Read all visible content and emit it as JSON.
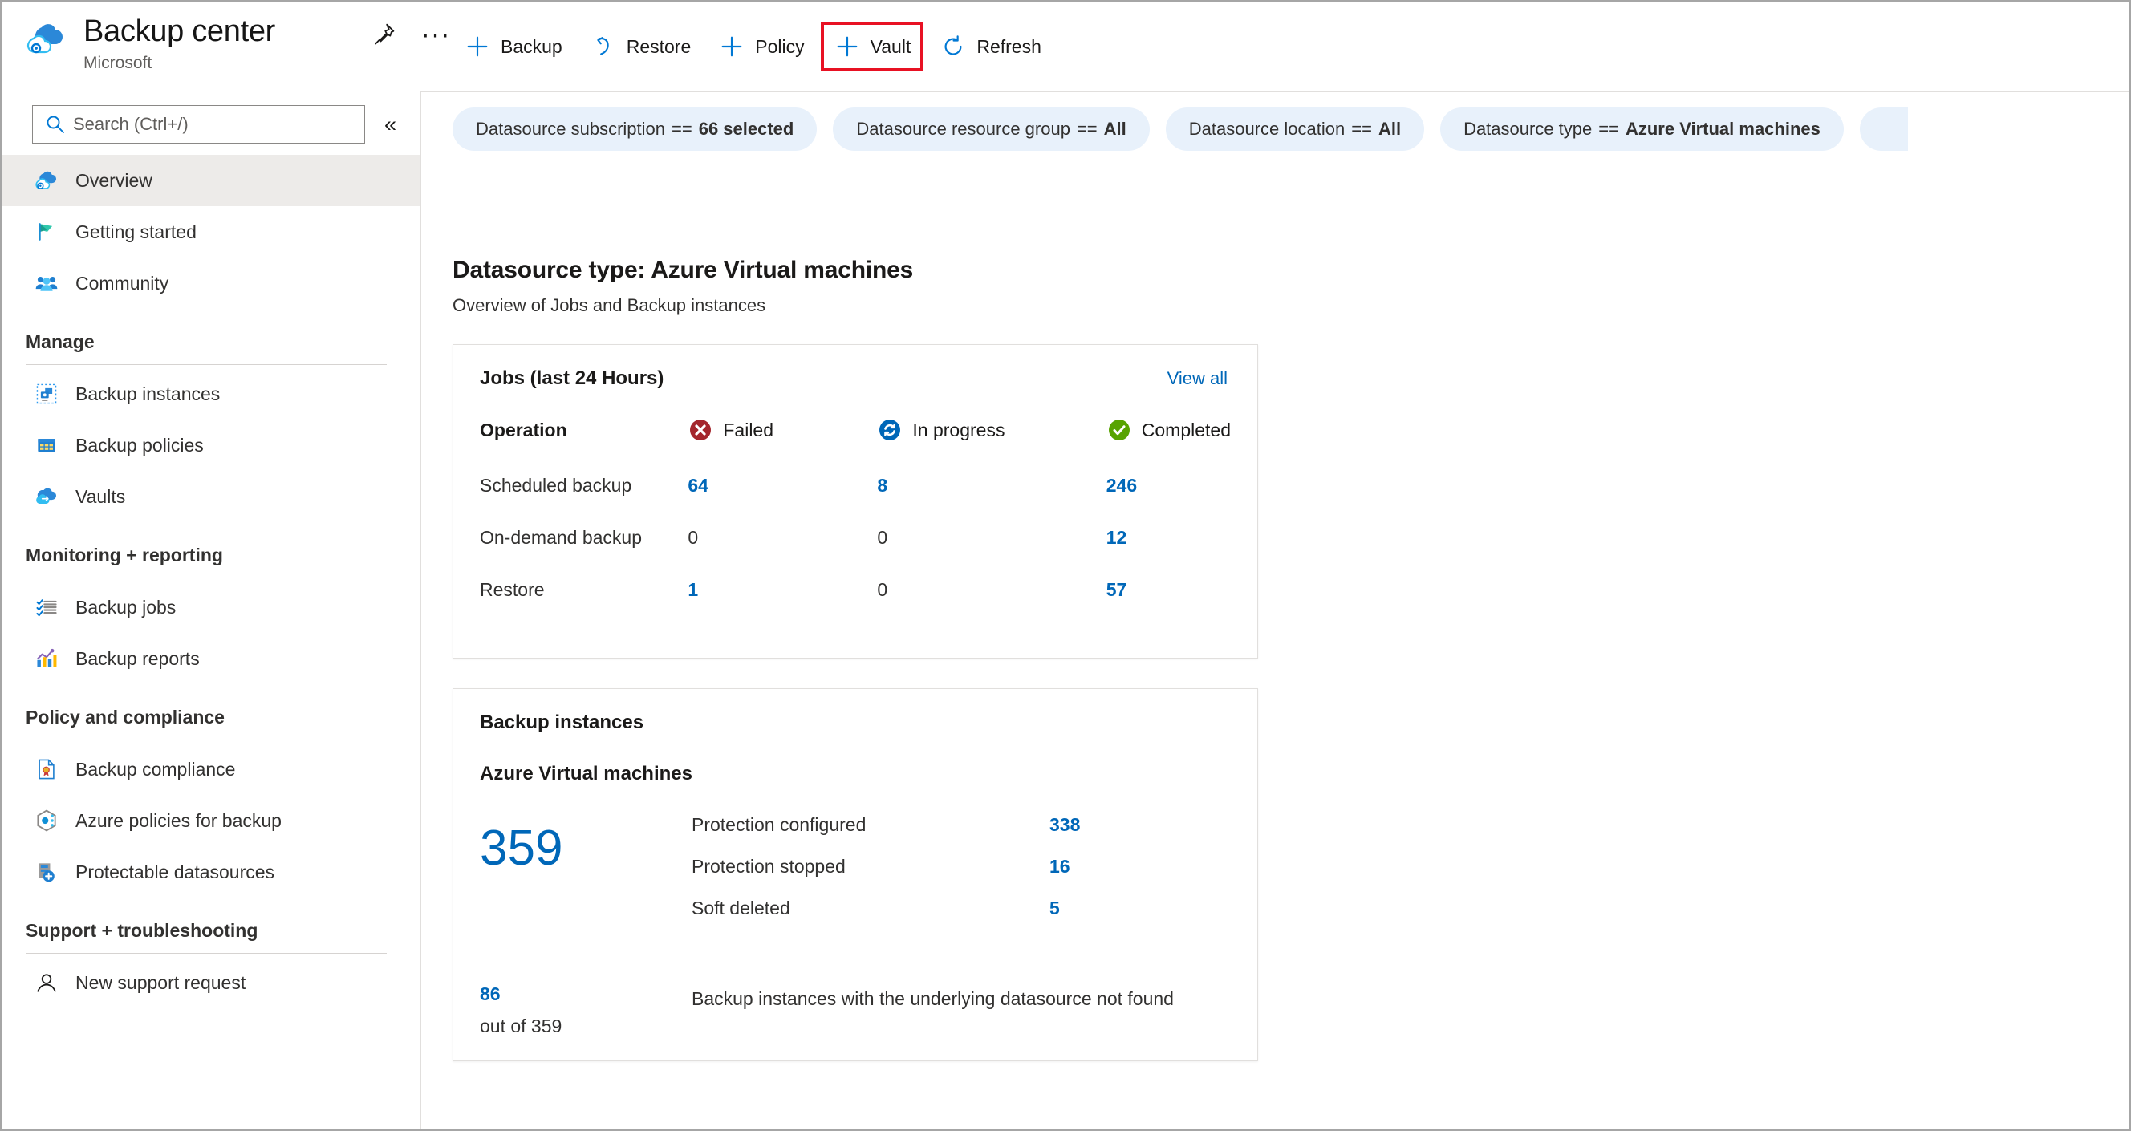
{
  "header": {
    "title": "Backup center",
    "subtitle": "Microsoft",
    "pin_icon": "pin-icon",
    "more_icon": "ellipsis-icon"
  },
  "search": {
    "placeholder": "Search (Ctrl+/)",
    "value": "",
    "icon": "search-icon",
    "collapse_icon": "chevron-double-left-icon"
  },
  "sidebar": {
    "top_items": [
      {
        "label": "Overview",
        "icon": "backup-center-cloud-icon",
        "active": true
      },
      {
        "label": "Getting started",
        "icon": "flag-icon",
        "active": false
      },
      {
        "label": "Community",
        "icon": "people-icon",
        "active": false
      }
    ],
    "groups": [
      {
        "title": "Manage",
        "items": [
          {
            "label": "Backup instances",
            "icon": "backup-instance-icon"
          },
          {
            "label": "Backup policies",
            "icon": "policy-grid-icon"
          },
          {
            "label": "Vaults",
            "icon": "vault-cloud-icon"
          }
        ]
      },
      {
        "title": "Monitoring + reporting",
        "items": [
          {
            "label": "Backup jobs",
            "icon": "checklist-icon"
          },
          {
            "label": "Backup reports",
            "icon": "bar-chart-icon"
          }
        ]
      },
      {
        "title": "Policy and compliance",
        "items": [
          {
            "label": "Backup compliance",
            "icon": "document-seal-icon"
          },
          {
            "label": "Azure policies for backup",
            "icon": "azure-policy-icon"
          },
          {
            "label": "Protectable datasources",
            "icon": "datasource-add-icon"
          }
        ]
      },
      {
        "title": "Support + troubleshooting",
        "items": [
          {
            "label": "New support request",
            "icon": "support-person-icon"
          }
        ]
      }
    ]
  },
  "toolbar": {
    "buttons": [
      {
        "label": "Backup",
        "icon": "plus-icon",
        "highlighted": false
      },
      {
        "label": "Restore",
        "icon": "undo-icon",
        "highlighted": false
      },
      {
        "label": "Policy",
        "icon": "plus-icon",
        "highlighted": false
      },
      {
        "label": "Vault",
        "icon": "plus-icon",
        "highlighted": true
      },
      {
        "label": "Refresh",
        "icon": "refresh-icon",
        "highlighted": false
      }
    ],
    "highlight_color": "#e81123"
  },
  "filters": [
    {
      "name": "Datasource subscription",
      "operator": "==",
      "value": "66 selected"
    },
    {
      "name": "Datasource resource group",
      "operator": "==",
      "value": "All"
    },
    {
      "name": "Datasource location",
      "operator": "==",
      "value": "All"
    },
    {
      "name": "Datasource type",
      "operator": "==",
      "value": "Azure Virtual machines"
    }
  ],
  "main": {
    "page_title": "Datasource type: Azure Virtual machines",
    "page_subtitle": "Overview of Jobs and Backup instances",
    "jobs_card": {
      "title": "Jobs (last 24 Hours)",
      "view_all": "View all",
      "operation_header": "Operation",
      "statuses": [
        {
          "label": "Failed",
          "icon": "error-circle-icon",
          "color": "#a4262c"
        },
        {
          "label": "In progress",
          "icon": "sync-circle-icon",
          "color": "#0067b8"
        },
        {
          "label": "Completed",
          "icon": "checkmark-circle-icon",
          "color": "#57a300"
        }
      ],
      "rows": [
        {
          "operation": "Scheduled backup",
          "failed": "64",
          "in_progress": "8",
          "completed": "246"
        },
        {
          "operation": "On-demand backup",
          "failed": "0",
          "in_progress": "0",
          "completed": "12"
        },
        {
          "operation": "Restore",
          "failed": "1",
          "in_progress": "0",
          "completed": "57"
        }
      ]
    },
    "instances_card": {
      "title": "Backup instances",
      "subtitle": "Azure Virtual machines",
      "total": "359",
      "rows": [
        {
          "label": "Protection configured",
          "value": "338"
        },
        {
          "label": "Protection stopped",
          "value": "16"
        },
        {
          "label": "Soft deleted",
          "value": "5"
        }
      ],
      "footer_number": "86",
      "footer_out_of": "out of 359",
      "footer_text": "Backup instances with the underlying datasource not found"
    }
  },
  "colors": {
    "link": "#0067b8",
    "chip_bg": "#e8f1fb",
    "active_nav_bg": "#edebe9"
  }
}
